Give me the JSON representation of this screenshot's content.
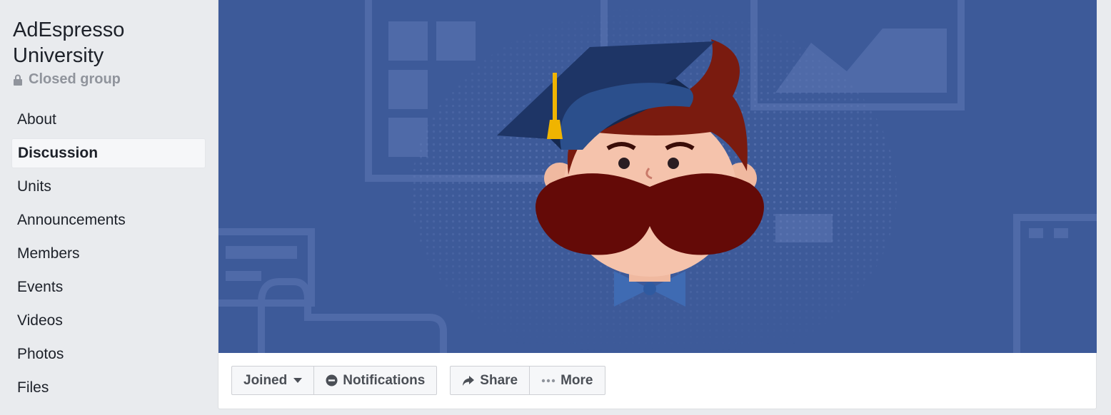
{
  "group": {
    "name": "AdEspresso University",
    "privacy": "Closed group"
  },
  "nav": {
    "items": [
      {
        "label": "About"
      },
      {
        "label": "Discussion",
        "active": true
      },
      {
        "label": "Units"
      },
      {
        "label": "Announcements"
      },
      {
        "label": "Members"
      },
      {
        "label": "Events"
      },
      {
        "label": "Videos"
      },
      {
        "label": "Photos"
      },
      {
        "label": "Files"
      }
    ]
  },
  "actions": {
    "joined_label": "Joined",
    "notifications_label": "Notifications",
    "share_label": "Share",
    "more_label": "More"
  },
  "icons": {
    "privacy": "lock-icon",
    "joined": "caret-down-icon",
    "notifications": "no-entry-icon",
    "share": "share-arrow-icon",
    "more": "ellipsis-icon"
  },
  "colors": {
    "cover_background": "#3d5a99",
    "page_background": "#e9ebee",
    "button_background": "#f6f7f9"
  }
}
